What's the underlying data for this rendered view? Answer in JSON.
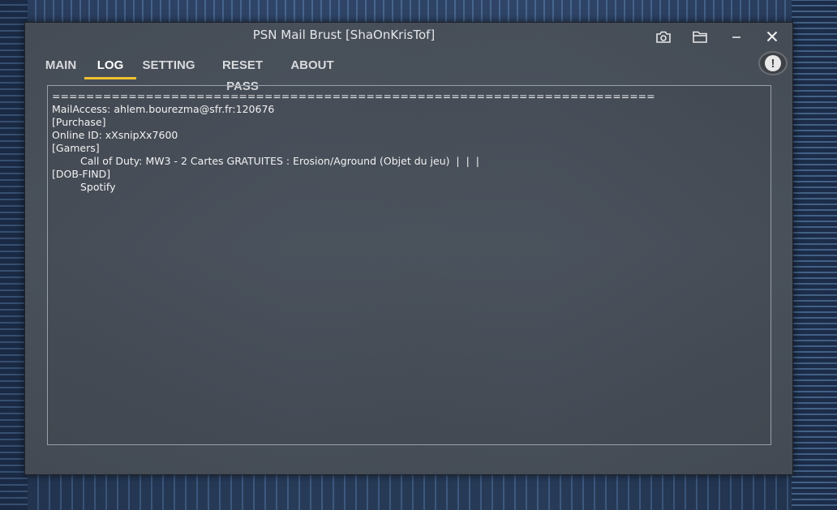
{
  "window": {
    "title": "PSN Mail Brust [ShaOnKrisTof]",
    "controls": [
      {
        "name": "camera-icon"
      },
      {
        "name": "folder-icon"
      },
      {
        "name": "minimize-icon"
      },
      {
        "name": "close-icon"
      }
    ]
  },
  "tabs": {
    "main": "MAIN",
    "log": "LOG",
    "setting": "SETTING",
    "reset_pass": "RESET PASS",
    "about": "ABOUT",
    "active": "LOG"
  },
  "info_button": {
    "glyph": "!",
    "icon": "alert-icon"
  },
  "log": {
    "lines": [
      "=======================================================================",
      "MailAccess: ahlem.bourezma@sfr.fr:120676",
      "[Purchase]",
      "Online ID: xXsnipXx7600",
      "[Gamers]",
      "Call of Duty: MW3 - 2 Cartes GRATUITES : Erosion/Aground (Objet du jeu)  |  |  |",
      "[DOB-FIND]",
      "Spotify"
    ]
  },
  "colors": {
    "accent_underline": "#f2c12e",
    "window_bg": "#4a5058",
    "text": "#f2f2f2"
  }
}
